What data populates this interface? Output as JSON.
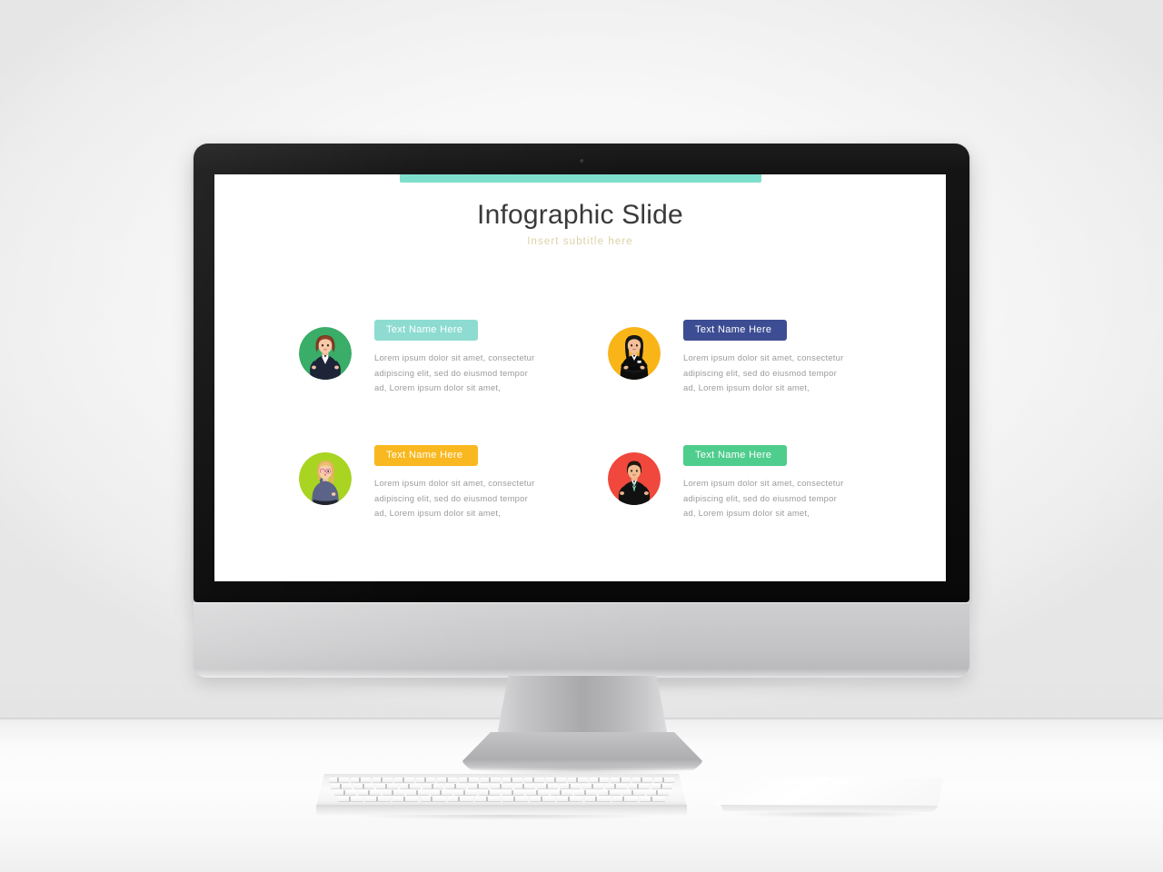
{
  "scene": {
    "device": "imac-desktop-computer",
    "accessories": [
      "keyboard",
      "trackpad"
    ]
  },
  "slide": {
    "accent_bar_color": "#7fdfcd",
    "title": "Infographic Slide",
    "subtitle": "Insert  subtitle  here",
    "subtitle_color": "#ddd1a6",
    "title_color": "#3a3a3a",
    "background": "#ffffff",
    "cards": [
      {
        "id": "card-1",
        "badge_label": "Text Name Here",
        "badge_color": "#8edcd1",
        "avatar_bg": "#3aad68",
        "avatar_alt": "woman-auburn-hair-navy-blazer",
        "description": "Lorem  ipsum  dolor  sit amet,  consectetur adipiscing  elit, sed do eiusmod  tempor ad,  Lorem  ipsum  dolor  sit amet,"
      },
      {
        "id": "card-2",
        "badge_label": "Text Name Here",
        "badge_color": "#3d4d93",
        "avatar_bg": "#f9b418",
        "avatar_alt": "woman-dark-hair-arms-crossed-black-suit",
        "description": "Lorem  ipsum  dolor  sit amet,  consectetur adipiscing  elit, sed do eiusmod  tempor ad,  Lorem  ipsum  dolor  sit amet,"
      },
      {
        "id": "card-3",
        "badge_label": "Text Name Here",
        "badge_color": "#f9b81f",
        "avatar_bg": "#a9d422",
        "avatar_alt": "blonde-woman-glasses-slate-blouse",
        "description": "Lorem  ipsum  dolor  sit amet,  consectetur adipiscing  elit, sed do eiusmod  tempor ad,  Lorem  ipsum  dolor  sit amet,"
      },
      {
        "id": "card-4",
        "badge_label": "Text Name Here",
        "badge_color": "#4fcd8d",
        "avatar_bg": "#f0483c",
        "avatar_alt": "man-black-suit-mint-tie",
        "description": "Lorem  ipsum  dolor  sit amet,  consectetur adipiscing  elit, sed do eiusmod  tempor ad,  Lorem  ipsum  dolor  sit amet,"
      }
    ]
  }
}
